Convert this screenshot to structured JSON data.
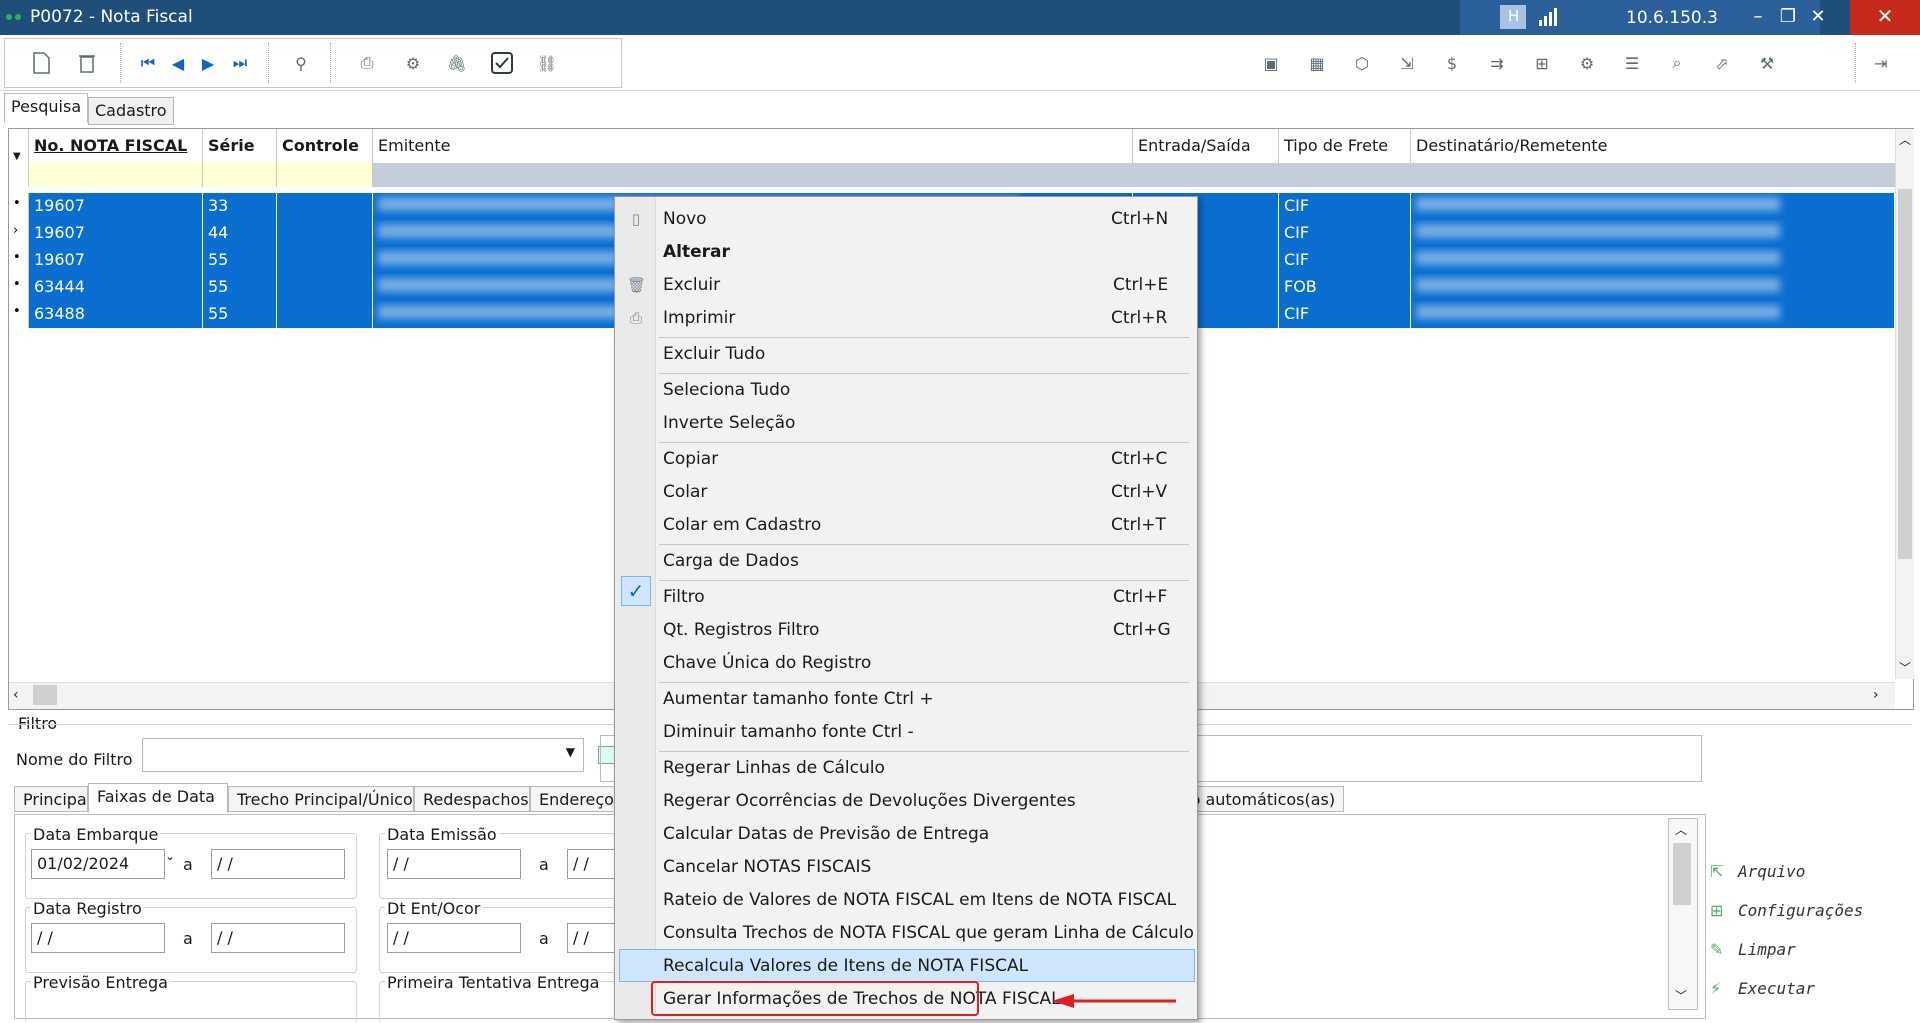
{
  "window": {
    "title": "P0072 - Nota Fiscal",
    "ip": "10.6.150.3",
    "conn_letter": "H"
  },
  "tabs_top": [
    "Pesquisa",
    "Cadastro"
  ],
  "grid": {
    "headers": [
      "No. NOTA FISCAL",
      "Série",
      "Controle",
      "Emitente",
      "Entrada/Saída",
      "Tipo de Frete",
      "Destinatário/Remetente"
    ],
    "rows": [
      {
        "nf": "19607",
        "serie": "33",
        "frete": "CIF"
      },
      {
        "nf": "19607",
        "serie": "44",
        "frete": "CIF"
      },
      {
        "nf": "19607",
        "serie": "55",
        "frete": "CIF"
      },
      {
        "nf": "63444",
        "serie": "55",
        "frete": "FOB"
      },
      {
        "nf": "63488",
        "serie": "55",
        "frete": "CIF"
      }
    ]
  },
  "filter": {
    "label": "Filtro",
    "nome_label": "Nome do Filtro",
    "nome_value": ""
  },
  "subtabs": [
    "Principal",
    "Faixas de Data",
    "Trecho Principal/Único",
    "Redespachos",
    "Endereço Co",
    "ulo automáticos(as)"
  ],
  "panel": {
    "data_embarque": "Data Embarque",
    "data_emissao": "Data Emissão",
    "data_registro": "Data Registro",
    "dt_ent": "Dt Ent/Ocor",
    "previsao": "Previsão Entrega",
    "primeira": "Primeira Tentativa Entrega",
    "a": "a",
    "embarque_from": "01/02/2024",
    "empty_date": " / /"
  },
  "side_actions": [
    "Arquivo",
    "Configurações",
    "Limpar",
    "Executar"
  ],
  "menu": {
    "novo": "Novo",
    "novo_sc": "Ctrl+N",
    "alterar": "Alterar",
    "excluir": "Excluir",
    "excluir_sc": "Ctrl+E",
    "imprimir": "Imprimir",
    "imprimir_sc": "Ctrl+R",
    "excluir_tudo": "Excluir Tudo",
    "seleciona_tudo": "Seleciona Tudo",
    "inverte": "Inverte Seleção",
    "copiar": "Copiar",
    "copiar_sc": "Ctrl+C",
    "colar": "Colar",
    "colar_sc": "Ctrl+V",
    "colar_cad": "Colar em Cadastro",
    "colar_cad_sc": "Ctrl+T",
    "carga": "Carga de Dados",
    "filtro": "Filtro",
    "filtro_sc": "Ctrl+F",
    "qt_reg": "Qt. Registros Filtro",
    "qt_reg_sc": "Ctrl+G",
    "chave": "Chave Única do Registro",
    "aumentar": "Aumentar tamanho fonte  Ctrl +",
    "diminuir": "Diminuir tamanho fonte  Ctrl -",
    "regerar_linhas": "Regerar Linhas de Cálculo",
    "regerar_ocorr": "Regerar Ocorrências de Devoluções Divergentes",
    "calc_datas": "Calcular Datas de Previsão de Entrega",
    "cancelar": "Cancelar NOTAS FISCAIS",
    "rateio": "Rateio de Valores de NOTA FISCAL em Itens de NOTA FISCAL",
    "consulta": "Consulta Trechos de NOTA FISCAL que geram Linha de Cálculo",
    "recalcula": "Recalcula Valores de Itens de NOTA FISCAL",
    "gerar": "Gerar Informações de Trechos de NOTA FISCAL"
  },
  "colors": {
    "title_bar": "#1f4e78",
    "selection": "#0a6ed1",
    "highlight_box": "#e02020"
  }
}
